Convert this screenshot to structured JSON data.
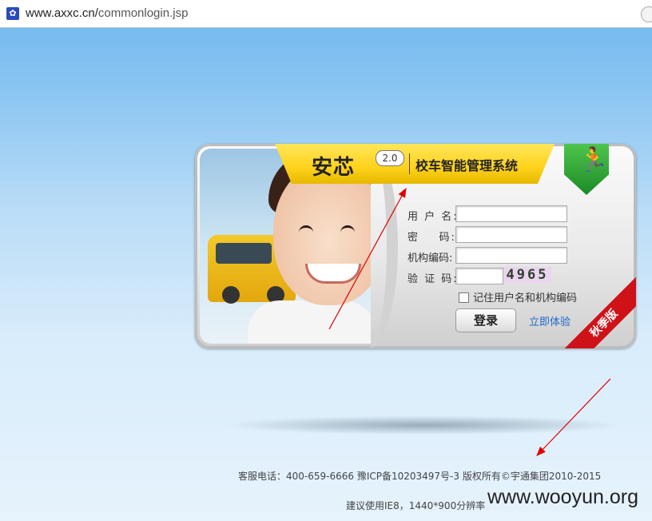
{
  "browser": {
    "url_host": "www.axxc.cn/",
    "url_path": "commonlogin.jsp",
    "favicon_icon": "paw-icon"
  },
  "header": {
    "brand": "安芯",
    "version": "2.0",
    "system_name": "校车智能管理系统",
    "shield_icon": "exit-man-icon"
  },
  "form": {
    "username_label": "用 户 名:",
    "password_label": "密    码:",
    "org_code_label": "机构编码:",
    "captcha_label": "验 证 码:",
    "captcha_value": "4965",
    "remember_label": "记住用户名和机构编码",
    "login_button": "登录",
    "trial_link": "立即体验"
  },
  "ribbon_text": "秋季版",
  "footer": {
    "line1": "客服电话：400-659-6666 豫ICP备10203497号-3 版权所有©宇通集团2010-2015",
    "line2": "建议使用IE8，1440*900分辨率"
  },
  "watermark": "www.wooyun.org",
  "colors": {
    "accent_yellow": "#ffd21b",
    "ribbon_red": "#cf1218",
    "link_blue": "#1e68c6",
    "annotation_red": "#e00000"
  }
}
